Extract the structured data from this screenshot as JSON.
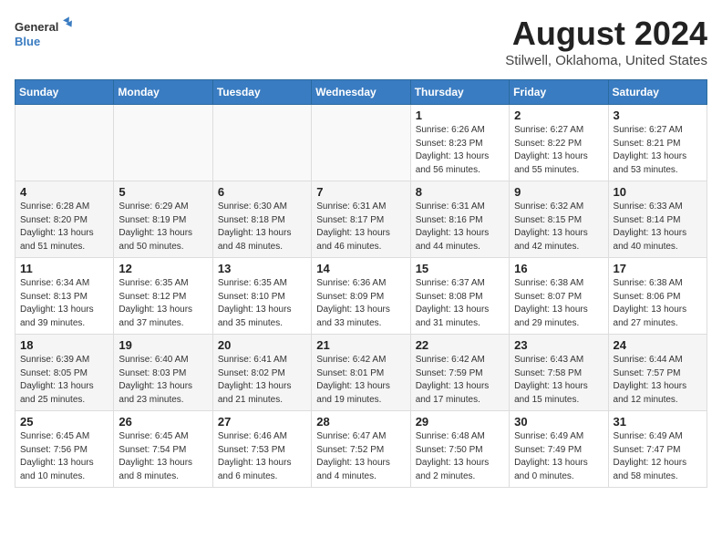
{
  "logo": {
    "line1": "General",
    "line2": "Blue"
  },
  "title": "August 2024",
  "subtitle": "Stilwell, Oklahoma, United States",
  "days_of_week": [
    "Sunday",
    "Monday",
    "Tuesday",
    "Wednesday",
    "Thursday",
    "Friday",
    "Saturday"
  ],
  "weeks": [
    [
      {
        "day": "",
        "info": ""
      },
      {
        "day": "",
        "info": ""
      },
      {
        "day": "",
        "info": ""
      },
      {
        "day": "",
        "info": ""
      },
      {
        "day": "1",
        "info": "Sunrise: 6:26 AM\nSunset: 8:23 PM\nDaylight: 13 hours\nand 56 minutes."
      },
      {
        "day": "2",
        "info": "Sunrise: 6:27 AM\nSunset: 8:22 PM\nDaylight: 13 hours\nand 55 minutes."
      },
      {
        "day": "3",
        "info": "Sunrise: 6:27 AM\nSunset: 8:21 PM\nDaylight: 13 hours\nand 53 minutes."
      }
    ],
    [
      {
        "day": "4",
        "info": "Sunrise: 6:28 AM\nSunset: 8:20 PM\nDaylight: 13 hours\nand 51 minutes."
      },
      {
        "day": "5",
        "info": "Sunrise: 6:29 AM\nSunset: 8:19 PM\nDaylight: 13 hours\nand 50 minutes."
      },
      {
        "day": "6",
        "info": "Sunrise: 6:30 AM\nSunset: 8:18 PM\nDaylight: 13 hours\nand 48 minutes."
      },
      {
        "day": "7",
        "info": "Sunrise: 6:31 AM\nSunset: 8:17 PM\nDaylight: 13 hours\nand 46 minutes."
      },
      {
        "day": "8",
        "info": "Sunrise: 6:31 AM\nSunset: 8:16 PM\nDaylight: 13 hours\nand 44 minutes."
      },
      {
        "day": "9",
        "info": "Sunrise: 6:32 AM\nSunset: 8:15 PM\nDaylight: 13 hours\nand 42 minutes."
      },
      {
        "day": "10",
        "info": "Sunrise: 6:33 AM\nSunset: 8:14 PM\nDaylight: 13 hours\nand 40 minutes."
      }
    ],
    [
      {
        "day": "11",
        "info": "Sunrise: 6:34 AM\nSunset: 8:13 PM\nDaylight: 13 hours\nand 39 minutes."
      },
      {
        "day": "12",
        "info": "Sunrise: 6:35 AM\nSunset: 8:12 PM\nDaylight: 13 hours\nand 37 minutes."
      },
      {
        "day": "13",
        "info": "Sunrise: 6:35 AM\nSunset: 8:10 PM\nDaylight: 13 hours\nand 35 minutes."
      },
      {
        "day": "14",
        "info": "Sunrise: 6:36 AM\nSunset: 8:09 PM\nDaylight: 13 hours\nand 33 minutes."
      },
      {
        "day": "15",
        "info": "Sunrise: 6:37 AM\nSunset: 8:08 PM\nDaylight: 13 hours\nand 31 minutes."
      },
      {
        "day": "16",
        "info": "Sunrise: 6:38 AM\nSunset: 8:07 PM\nDaylight: 13 hours\nand 29 minutes."
      },
      {
        "day": "17",
        "info": "Sunrise: 6:38 AM\nSunset: 8:06 PM\nDaylight: 13 hours\nand 27 minutes."
      }
    ],
    [
      {
        "day": "18",
        "info": "Sunrise: 6:39 AM\nSunset: 8:05 PM\nDaylight: 13 hours\nand 25 minutes."
      },
      {
        "day": "19",
        "info": "Sunrise: 6:40 AM\nSunset: 8:03 PM\nDaylight: 13 hours\nand 23 minutes."
      },
      {
        "day": "20",
        "info": "Sunrise: 6:41 AM\nSunset: 8:02 PM\nDaylight: 13 hours\nand 21 minutes."
      },
      {
        "day": "21",
        "info": "Sunrise: 6:42 AM\nSunset: 8:01 PM\nDaylight: 13 hours\nand 19 minutes."
      },
      {
        "day": "22",
        "info": "Sunrise: 6:42 AM\nSunset: 7:59 PM\nDaylight: 13 hours\nand 17 minutes."
      },
      {
        "day": "23",
        "info": "Sunrise: 6:43 AM\nSunset: 7:58 PM\nDaylight: 13 hours\nand 15 minutes."
      },
      {
        "day": "24",
        "info": "Sunrise: 6:44 AM\nSunset: 7:57 PM\nDaylight: 13 hours\nand 12 minutes."
      }
    ],
    [
      {
        "day": "25",
        "info": "Sunrise: 6:45 AM\nSunset: 7:56 PM\nDaylight: 13 hours\nand 10 minutes."
      },
      {
        "day": "26",
        "info": "Sunrise: 6:45 AM\nSunset: 7:54 PM\nDaylight: 13 hours\nand 8 minutes."
      },
      {
        "day": "27",
        "info": "Sunrise: 6:46 AM\nSunset: 7:53 PM\nDaylight: 13 hours\nand 6 minutes."
      },
      {
        "day": "28",
        "info": "Sunrise: 6:47 AM\nSunset: 7:52 PM\nDaylight: 13 hours\nand 4 minutes."
      },
      {
        "day": "29",
        "info": "Sunrise: 6:48 AM\nSunset: 7:50 PM\nDaylight: 13 hours\nand 2 minutes."
      },
      {
        "day": "30",
        "info": "Sunrise: 6:49 AM\nSunset: 7:49 PM\nDaylight: 13 hours\nand 0 minutes."
      },
      {
        "day": "31",
        "info": "Sunrise: 6:49 AM\nSunset: 7:47 PM\nDaylight: 12 hours\nand 58 minutes."
      }
    ]
  ]
}
